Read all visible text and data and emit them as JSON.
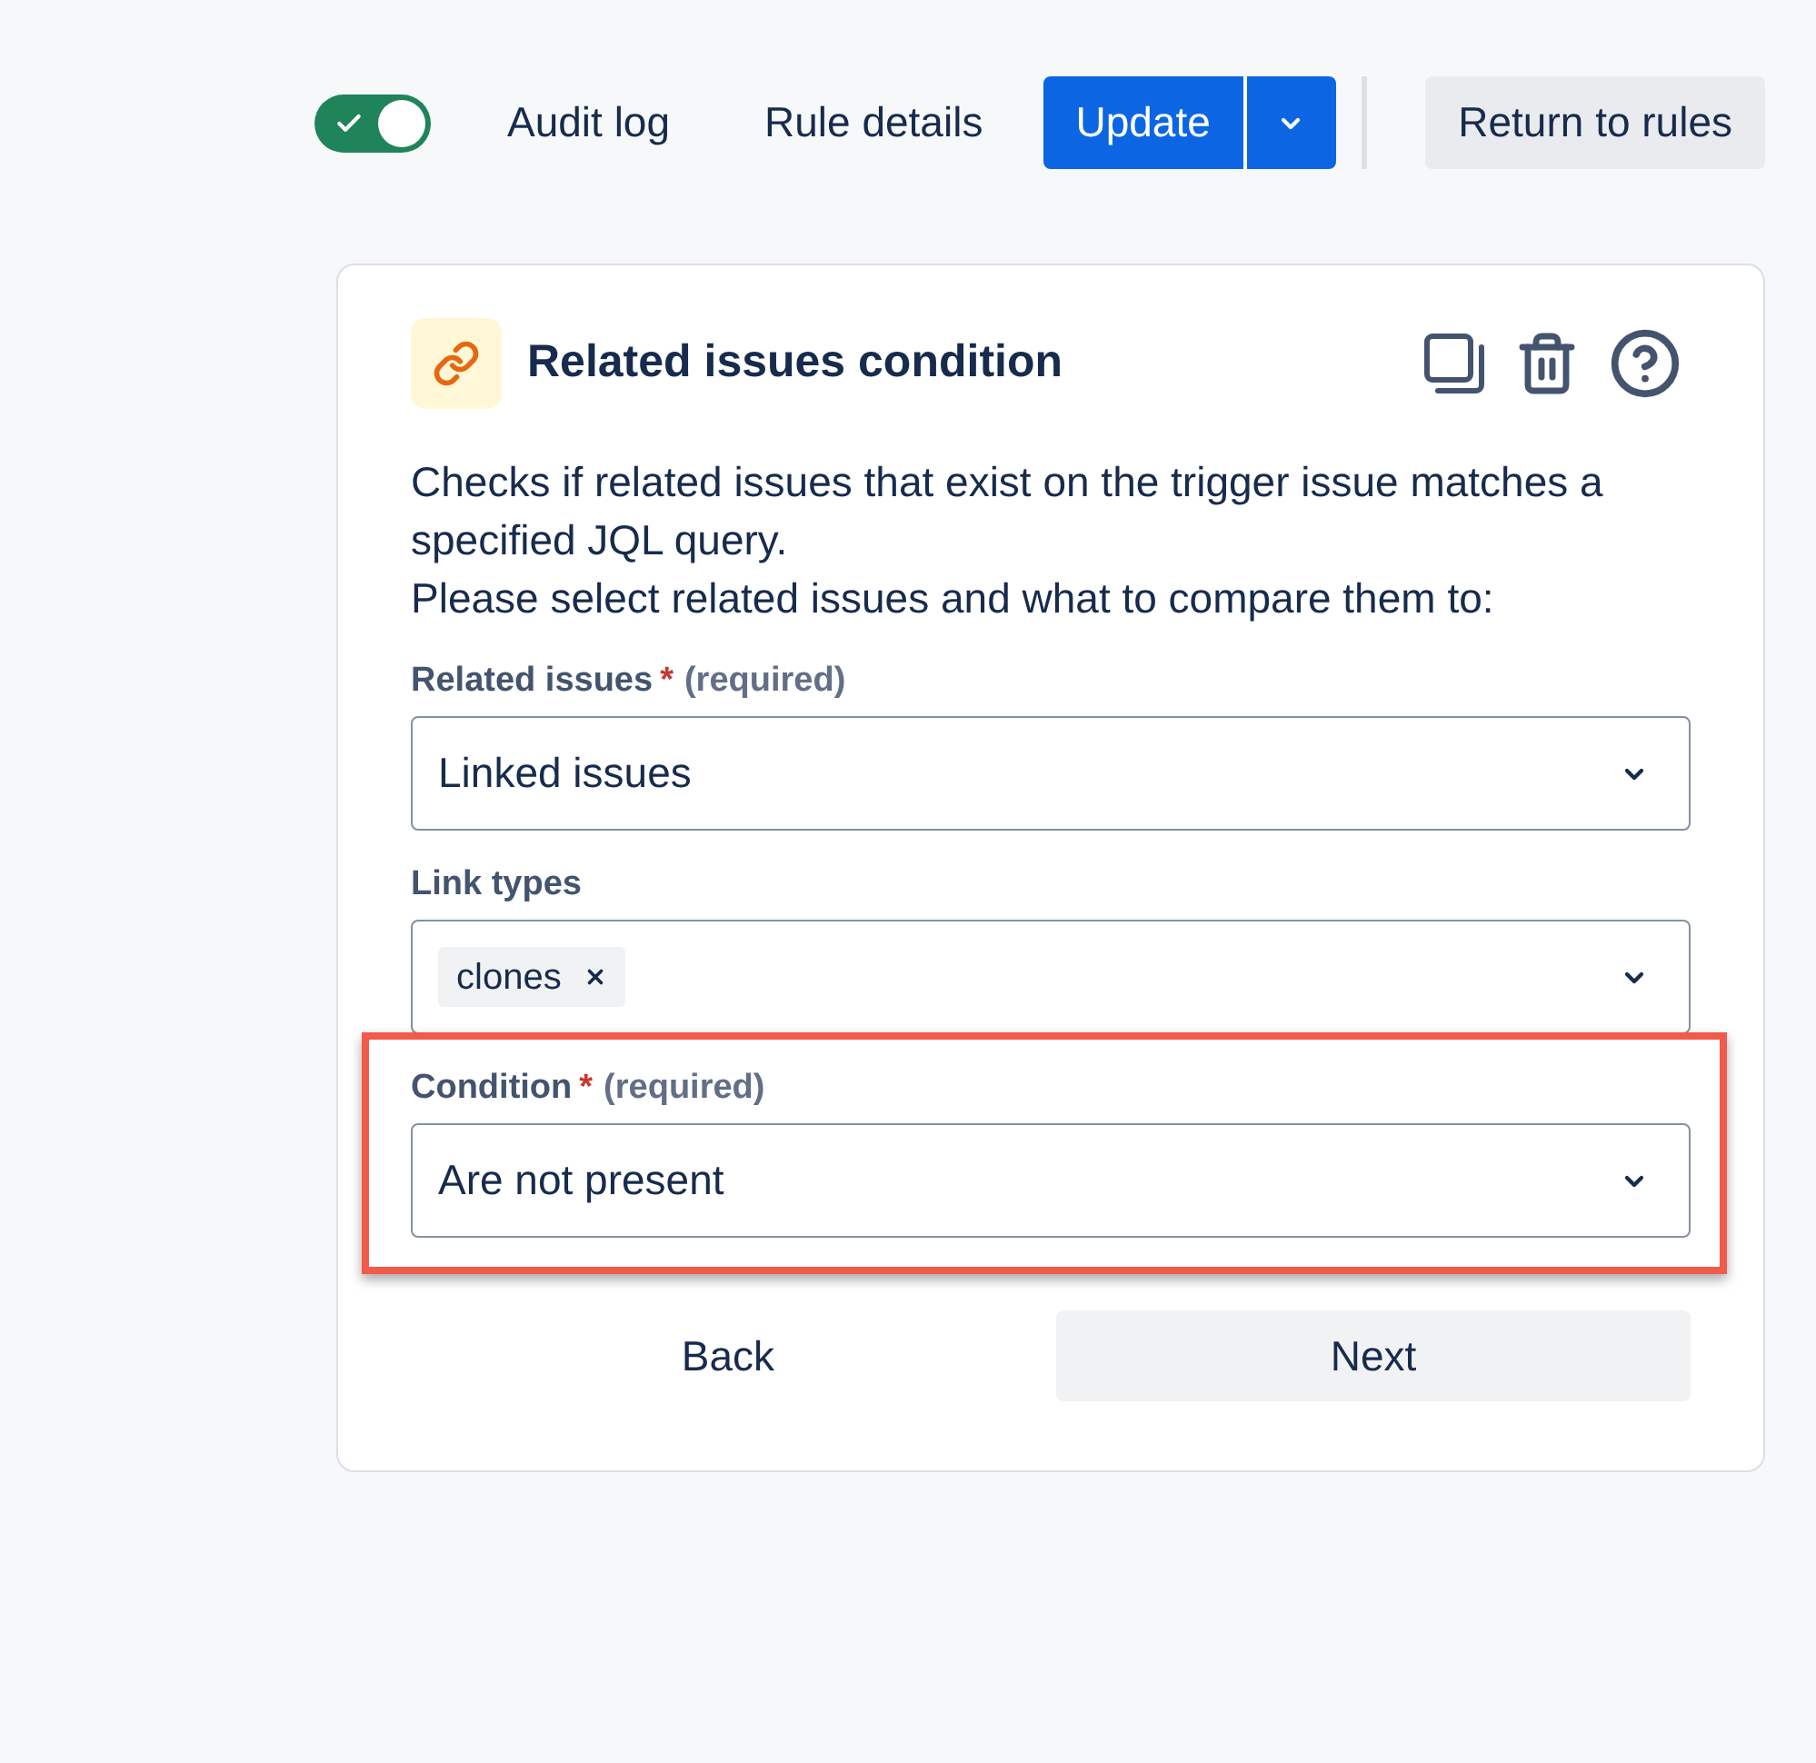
{
  "toolbar": {
    "toggle": {
      "on": true
    },
    "links": [
      {
        "label": "Audit log"
      },
      {
        "label": "Rule details"
      }
    ],
    "update_button": {
      "label": "Update"
    },
    "return_button": {
      "label": "Return to rules"
    }
  },
  "card": {
    "title": "Related issues condition",
    "description": [
      "Checks if related issues that exist on the trigger issue matches a specified JQL query.",
      "Please select related issues and what to compare them to:"
    ],
    "fields": [
      {
        "kind": "select",
        "label": "Related issues",
        "required_mark": "*",
        "required_note": "(required)",
        "value": "Linked issues",
        "highlighted": false
      },
      {
        "kind": "tags",
        "label": "Link types",
        "tags": [
          {
            "label": "clones"
          }
        ],
        "highlighted": false
      },
      {
        "kind": "select",
        "label": "Condition",
        "required_mark": "*",
        "required_note": "(required)",
        "value": "Are not present",
        "highlighted": true
      }
    ],
    "buttons": [
      {
        "label": "Back",
        "kind": "subtle"
      },
      {
        "label": "Next",
        "kind": "default"
      }
    ]
  }
}
